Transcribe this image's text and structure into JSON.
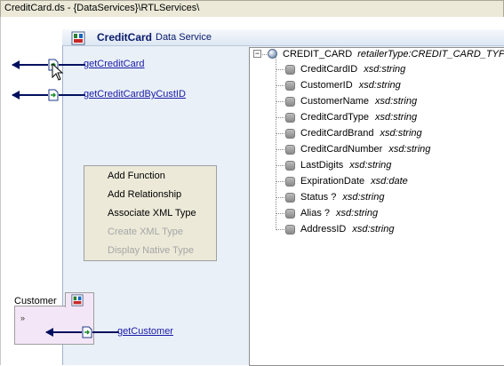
{
  "window": {
    "title": "CreditCard.ds - {DataServices}\\RTLServices\\"
  },
  "data_service": {
    "name": "CreditCard",
    "subtitle": "Data Service"
  },
  "operations": [
    {
      "label": "getCreditCard"
    },
    {
      "label": "getCreditCardByCustID"
    }
  ],
  "context_menu": {
    "items": [
      {
        "label": "Add Function",
        "enabled": true
      },
      {
        "label": "Add Relationship",
        "enabled": true
      },
      {
        "label": "Associate XML Type",
        "enabled": true
      },
      {
        "label": "Create XML Type",
        "enabled": false
      },
      {
        "label": "Display Native Type",
        "enabled": false
      }
    ]
  },
  "schema_tree": {
    "root": {
      "name": "CREDIT_CARD",
      "type": "retailerType:CREDIT_CARD_TYPE",
      "expander": "−"
    },
    "fields": [
      {
        "name": "CreditCardID",
        "type": "xsd:string"
      },
      {
        "name": "CustomerID",
        "type": "xsd:string"
      },
      {
        "name": "CustomerName",
        "type": "xsd:string"
      },
      {
        "name": "CreditCardType",
        "type": "xsd:string"
      },
      {
        "name": "CreditCardBrand",
        "type": "xsd:string"
      },
      {
        "name": "CreditCardNumber",
        "type": "xsd:string"
      },
      {
        "name": "LastDigits",
        "type": "xsd:string"
      },
      {
        "name": "ExpirationDate",
        "type": "xsd:date"
      },
      {
        "name": "Status ?",
        "type": "xsd:string"
      },
      {
        "name": "Alias ?",
        "type": "xsd:string"
      },
      {
        "name": "AddressID",
        "type": "xsd:string"
      }
    ]
  },
  "customer_service": {
    "name": "Customer",
    "collapse_glyph": "»",
    "operation": {
      "label": "getCustomer"
    }
  },
  "icons": {
    "data_service": "data-service-icon",
    "operation": "read-function-icon",
    "cursor": "mouse-pointer-icon"
  },
  "colors": {
    "link": "#1a1aa6",
    "arrow": "#00105e",
    "panel_bg": "#e9f0f8",
    "customer_bg": "#f3e6f6"
  }
}
